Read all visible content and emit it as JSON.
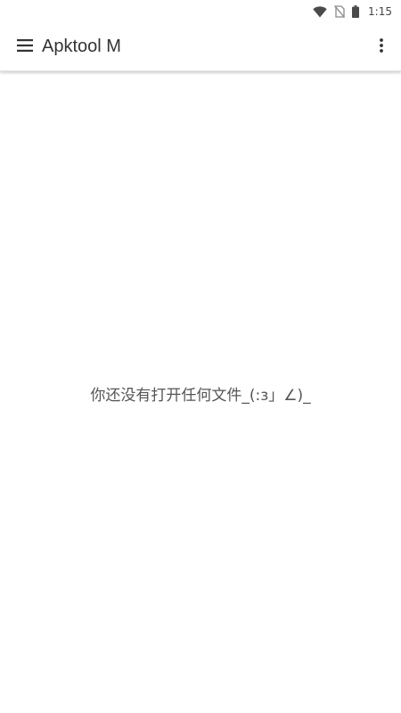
{
  "status_bar": {
    "time": "1:15",
    "icons": [
      "wifi-icon",
      "no-sim-icon",
      "battery-icon"
    ]
  },
  "app_bar": {
    "title": "Apktool M",
    "left_icon": "menu-icon",
    "right_icon": "more-vert-icon"
  },
  "content": {
    "empty_message": "你还没有打开任何文件_(:з」∠)_"
  },
  "colors": {
    "background": "#ffffff",
    "text_primary": "#333333",
    "text_secondary": "#555555"
  }
}
